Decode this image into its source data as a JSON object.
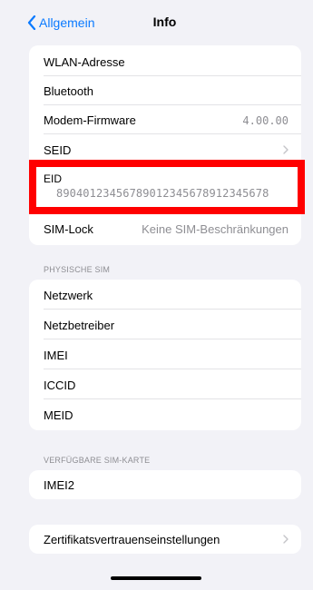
{
  "nav": {
    "back_label": "Allgemein",
    "title": "Info"
  },
  "group1": {
    "wlan": "WLAN-Adresse",
    "bluetooth": "Bluetooth",
    "modem_label": "Modem-Firmware",
    "modem_value": "4.00.00",
    "seid": "SEID",
    "eid_label": "EID",
    "eid_value": "89040123456789012345678912345678",
    "simlock_label": "SIM-Lock",
    "simlock_value": "Keine SIM-Beschränkungen"
  },
  "physical_sim": {
    "header": "PHYSISCHE SIM",
    "netzwerk": "Netzwerk",
    "netzbetreiber": "Netzbetreiber",
    "imei": "IMEI",
    "iccid": "ICCID",
    "meid": "MEID"
  },
  "available_sim": {
    "header": "VERFÜGBARE SIM-KARTE",
    "imei2": "IMEI2"
  },
  "certificates": {
    "label": "Zertifikatsvertrauenseinstellungen"
  },
  "colors": {
    "accent": "#0a7aff",
    "highlight": "#ff0000",
    "background": "#f2f2f7"
  }
}
